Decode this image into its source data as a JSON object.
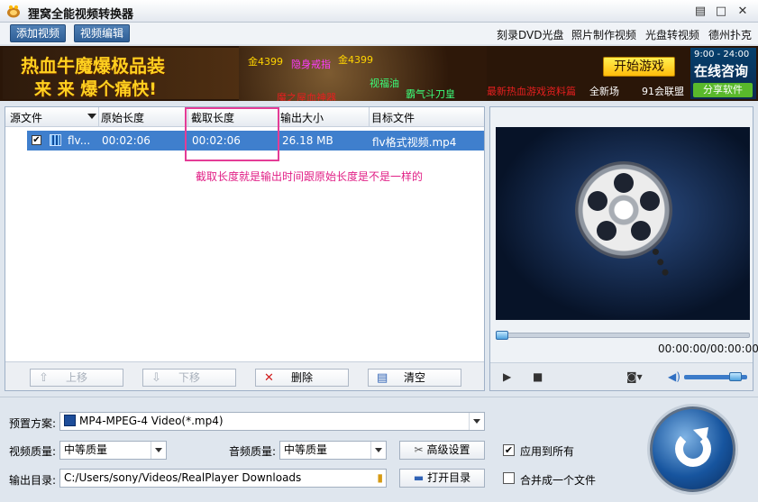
{
  "window": {
    "title": "狸窝全能视频转换器",
    "minimize": "▤",
    "maximize": "□",
    "close": "✕"
  },
  "toolbar": {
    "add_video": "添加视频",
    "edit_video": "视频编辑",
    "links": [
      "刻录DVD光盘",
      "照片制作视频",
      "光盘转视频",
      "德州扑克"
    ]
  },
  "banner": {
    "title1": "热血牛魔爆极品装",
    "title2": "来 来 爆个痛快!",
    "items": [
      "金4399",
      "隐身戒指",
      "金4399",
      "视福油",
      "霸气斗刀皇",
      "魔之屋血神器"
    ],
    "red_text": "最新热血游戏资料篇",
    "new_server": "全新场",
    "union": "91会联盟",
    "play_game": "开始游戏",
    "service_hours": "9:00 - 24:00",
    "online_consult": "在线咨询",
    "share": "分享软件"
  },
  "file_list": {
    "columns": [
      "源文件",
      "原始长度",
      "截取长度",
      "输出大小",
      "目标文件"
    ],
    "rows": [
      {
        "checked": true,
        "source": "flv...",
        "original_length": "00:02:06",
        "clip_length": "00:02:06",
        "output_size": "26.18 MB",
        "target": "flv格式视频.mp4"
      }
    ],
    "annotation": "截取长度就是输出时间跟原始长度是不是一样的",
    "buttons": {
      "up": "上移",
      "down": "下移",
      "delete": "删除",
      "clear": "清空"
    }
  },
  "preview": {
    "timecode": "00:00:00/00:00:00",
    "seek_fraction": 0,
    "volume_fraction": 0.9
  },
  "settings": {
    "preset_label": "预置方案:",
    "preset_value": "MP4-MPEG-4 Video(*.mp4)",
    "video_quality_label": "视频质量:",
    "video_quality": "中等质量",
    "audio_quality_label": "音频质量:",
    "audio_quality": "中等质量",
    "advanced": "高级设置",
    "apply_all": "应用到所有",
    "apply_all_checked": true,
    "output_dir_label": "输出目录:",
    "output_dir": "C:/Users/sony/Videos/RealPlayer Downloads",
    "open_dir": "打开目录",
    "merge": "合并成一个文件",
    "merge_checked": false
  }
}
